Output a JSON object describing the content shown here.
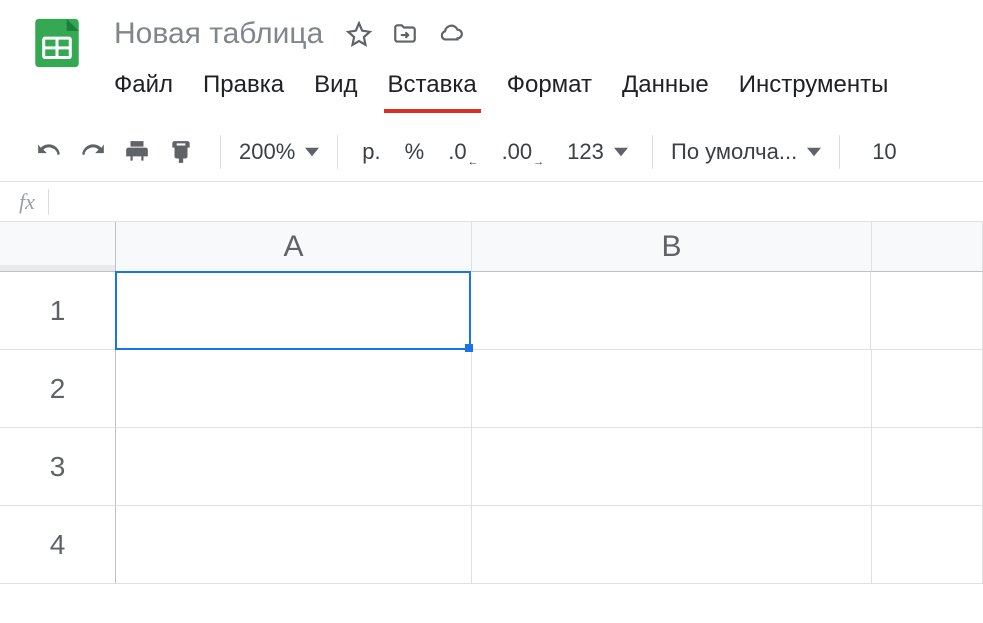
{
  "doc": {
    "title": "Новая таблица"
  },
  "menu": {
    "file": "Файл",
    "edit": "Правка",
    "view": "Вид",
    "insert": "Вставка",
    "format": "Формат",
    "data": "Данные",
    "tools": "Инструменты",
    "active": "insert"
  },
  "toolbar": {
    "zoom": "200%",
    "currency": "р.",
    "percent": "%",
    "dec_decrease": ".0",
    "dec_increase": ".00",
    "more_formats": "123",
    "font": "По умолча...",
    "font_size": "10"
  },
  "formula": {
    "fx_label": "fx",
    "value": ""
  },
  "grid": {
    "columns": [
      "A",
      "B"
    ],
    "rows": [
      "1",
      "2",
      "3",
      "4"
    ],
    "selected_cell": "A1"
  }
}
